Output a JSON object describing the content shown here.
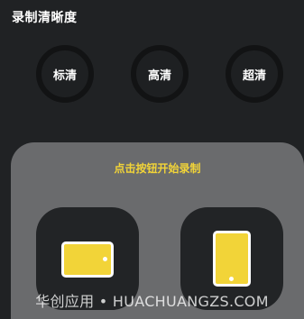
{
  "resolution": {
    "title": "录制清晰度",
    "options": [
      {
        "label": "标清"
      },
      {
        "label": "高清"
      },
      {
        "label": "超清"
      }
    ]
  },
  "record_panel": {
    "title": "点击按钮开始录制",
    "buttons": [
      {
        "icon": "landscape-device-icon"
      },
      {
        "icon": "portrait-device-icon"
      }
    ]
  },
  "watermark": {
    "text": "华创应用 • HUACHUANGZS.COM"
  },
  "colors": {
    "background": "#202224",
    "accent": "#f2d438",
    "panel": "#6a6b6d",
    "button": "#222426"
  }
}
